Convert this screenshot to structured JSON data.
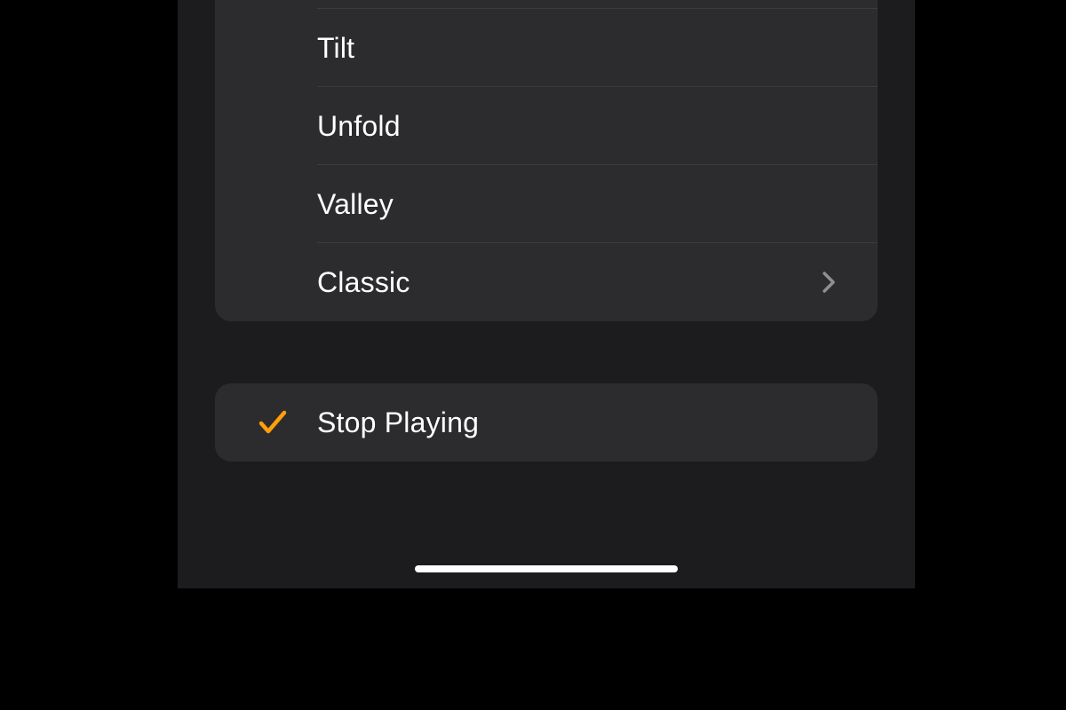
{
  "colors": {
    "accent": "#ff9f0a",
    "chevron": "#8e8e93"
  },
  "sound_options": {
    "items": [
      {
        "label": "Tilt",
        "disclosure": false
      },
      {
        "label": "Unfold",
        "disclosure": false
      },
      {
        "label": "Valley",
        "disclosure": false
      },
      {
        "label": "Classic",
        "disclosure": true
      }
    ]
  },
  "stop_option": {
    "label": "Stop Playing",
    "selected": true
  }
}
